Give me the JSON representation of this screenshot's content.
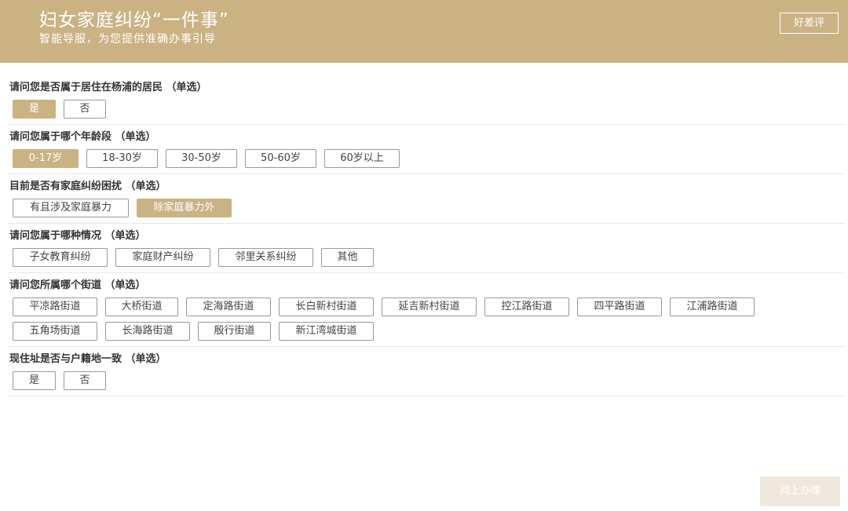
{
  "header": {
    "title": "妇女家庭纠纷“一件事”",
    "subtitle": "智能导服，为您提供准确办事引导",
    "rate_button": "好差评"
  },
  "questions": [
    {
      "title": "请问您是否属于居住在杨浦的居民 （单选）",
      "options": [
        "是",
        "否"
      ],
      "selected": 0
    },
    {
      "title": "请问您属于哪个年龄段 （单选）",
      "options": [
        "0-17岁",
        "18-30岁",
        "30-50岁",
        "50-60岁",
        "60岁以上"
      ],
      "selected": 0
    },
    {
      "title": "目前是否有家庭纠纷困扰 （单选）",
      "options": [
        "有且涉及家庭暴力",
        "除家庭暴力外"
      ],
      "selected": 1
    },
    {
      "title": "请问您属于哪种情况 （单选）",
      "options": [
        "子女教育纠纷",
        "家庭财产纠纷",
        "邻里关系纠纷",
        "其他"
      ],
      "selected": -1
    },
    {
      "title": "请问您所属哪个街道 （单选）",
      "options": [
        "平凉路街道",
        "大桥街道",
        "定海路街道",
        "长白新村街道",
        "延吉新村街道",
        "控江路街道",
        "四平路街道",
        "江浦路街道",
        "五角场街道",
        "长海路街道",
        "殷行街道",
        "新江湾城街道"
      ],
      "selected": -1
    },
    {
      "title": "现住址是否与户籍地一致 （单选）",
      "options": [
        "是",
        "否"
      ],
      "selected": -1
    }
  ],
  "footer": {
    "submit_label": "网上办理"
  },
  "colors": {
    "accent": "#cbb283",
    "submit_disabled": "#f0e8dc"
  }
}
